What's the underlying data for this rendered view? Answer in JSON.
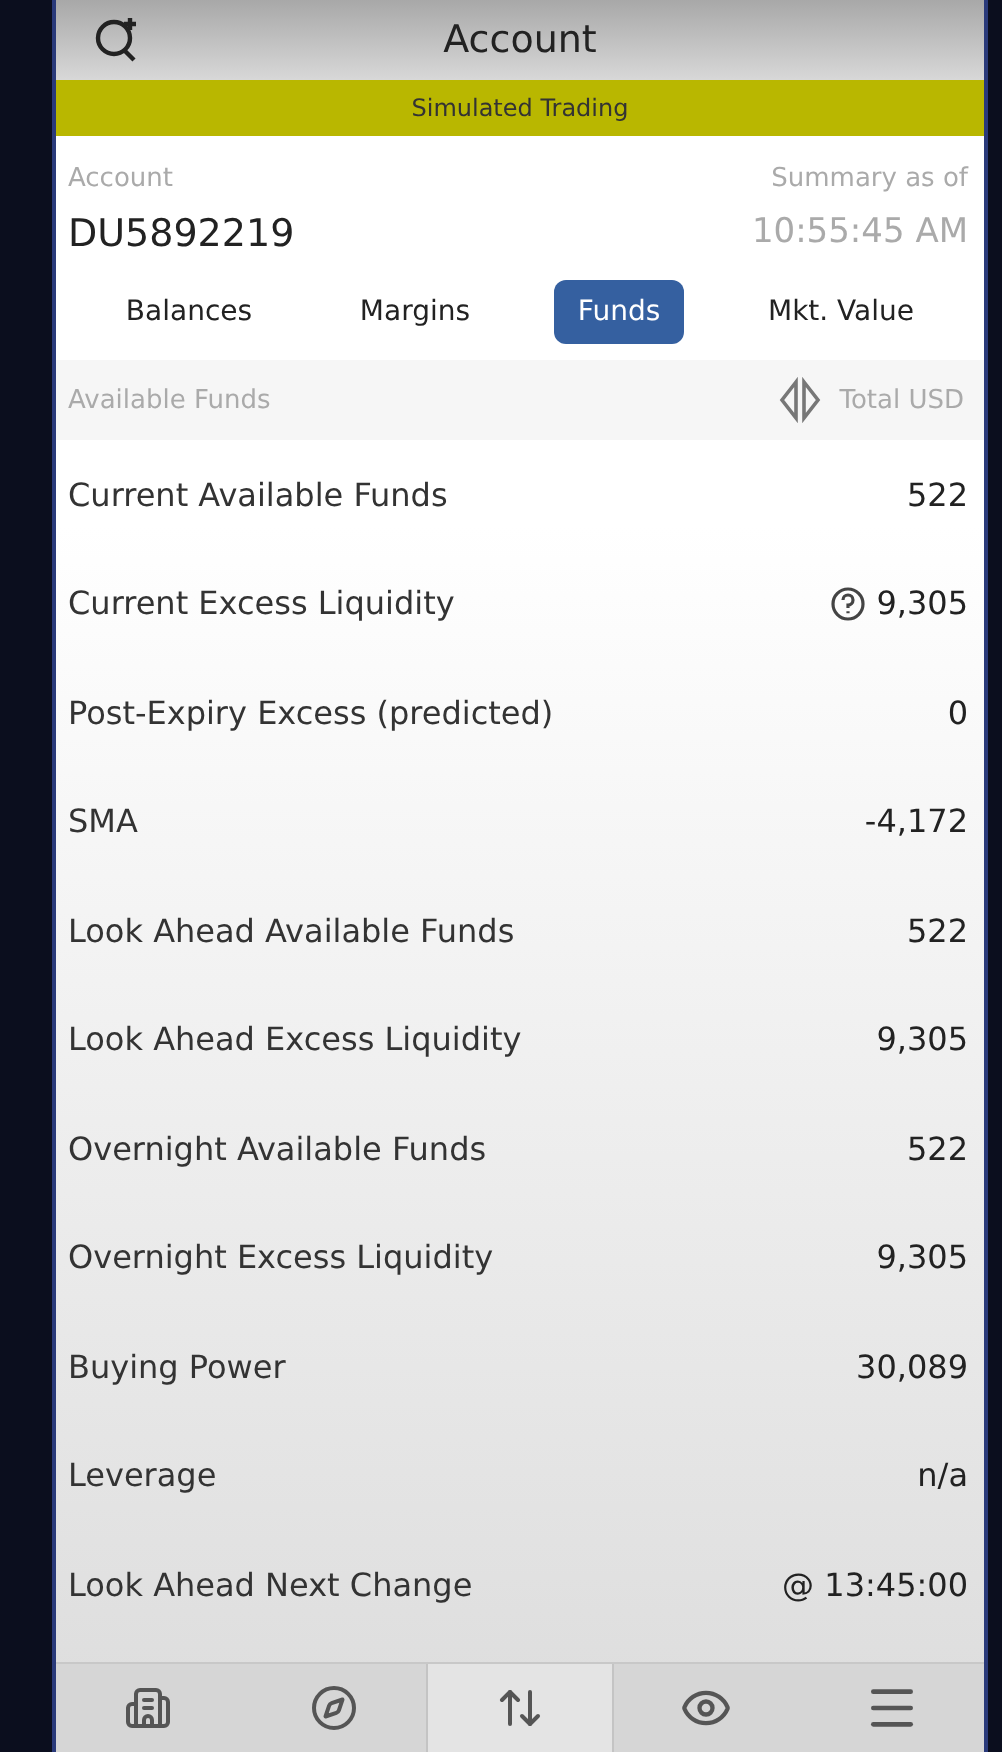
{
  "header": {
    "title": "Account"
  },
  "banner": "Simulated Trading",
  "account": {
    "label": "Account",
    "id": "DU5892219",
    "summary_label": "Summary as of",
    "time": "10:55:45 AM"
  },
  "tabs": [
    {
      "label": "Balances",
      "selected": false
    },
    {
      "label": "Margins",
      "selected": false
    },
    {
      "label": "Funds",
      "selected": true
    },
    {
      "label": "Mkt. Value",
      "selected": false
    }
  ],
  "section": {
    "title": "Available Funds",
    "currency": "Total USD"
  },
  "rows": [
    {
      "label": "Current Available Funds",
      "value": "522",
      "help": false
    },
    {
      "label": "Current Excess Liquidity",
      "value": "9,305",
      "help": true
    },
    {
      "label": "Post-Expiry Excess (predicted)",
      "value": "0",
      "help": false
    },
    {
      "label": "SMA",
      "value": "-4,172",
      "help": false
    },
    {
      "label": "Look Ahead Available Funds",
      "value": "522",
      "help": false
    },
    {
      "label": "Look Ahead Excess Liquidity",
      "value": "9,305",
      "help": false
    },
    {
      "label": "Overnight Available Funds",
      "value": "522",
      "help": false
    },
    {
      "label": "Overnight Excess Liquidity",
      "value": "9,305",
      "help": false
    },
    {
      "label": "Buying Power",
      "value": "30,089",
      "help": false
    },
    {
      "label": "Leverage",
      "value": "n/a",
      "help": false
    },
    {
      "label": "Look Ahead Next Change",
      "value": "@ 13:45:00",
      "help": false
    }
  ],
  "nav": [
    {
      "kind": "portfolio",
      "selected": false
    },
    {
      "kind": "explore",
      "selected": false
    },
    {
      "kind": "trade",
      "selected": true
    },
    {
      "kind": "watch",
      "selected": false
    },
    {
      "kind": "menu",
      "selected": false
    }
  ]
}
